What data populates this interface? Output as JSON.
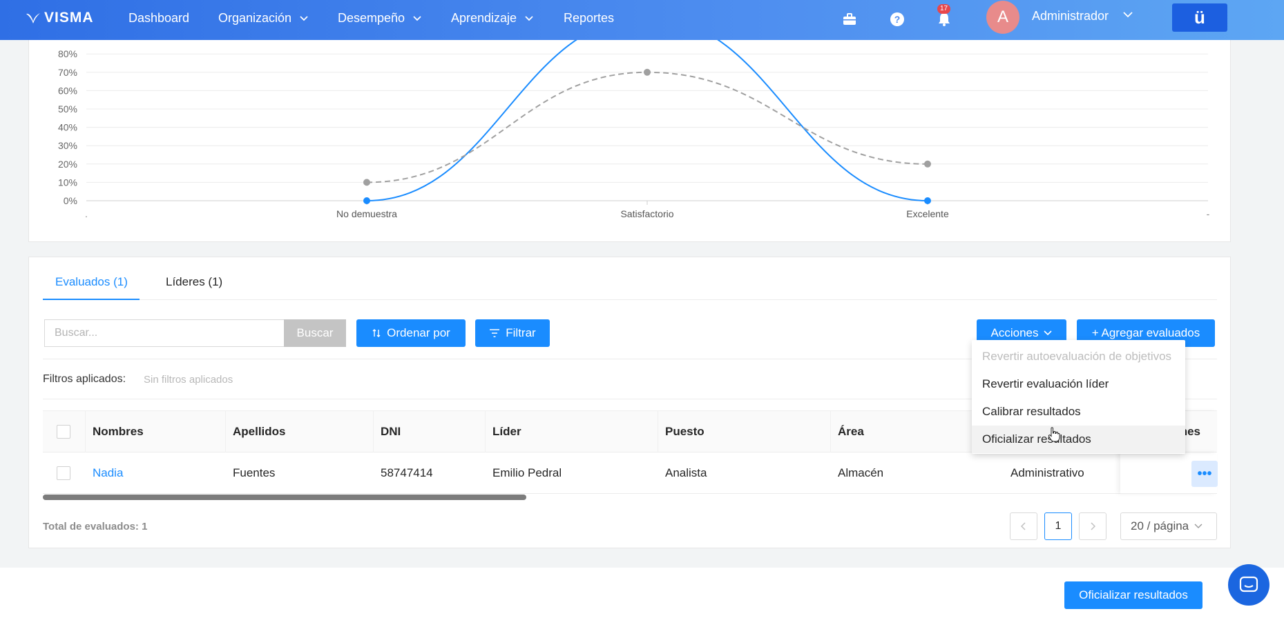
{
  "topbar": {
    "logo": "VISMA",
    "nav": [
      {
        "label": "Dashboard",
        "dropdown": false
      },
      {
        "label": "Organización",
        "dropdown": true
      },
      {
        "label": "Desempeño",
        "dropdown": true
      },
      {
        "label": "Aprendizaje",
        "dropdown": true
      },
      {
        "label": "Reportes",
        "dropdown": false
      }
    ],
    "icons": [
      "briefcase-icon",
      "help-icon",
      "bell-icon"
    ],
    "notification_count": "17",
    "avatar_initial": "A",
    "user_name": "Administrador",
    "app_button": "ü"
  },
  "chart_data": {
    "type": "line",
    "x_categories": [
      "No demuestra",
      "Satisfactorio",
      "Excelente"
    ],
    "x_edge_labels": [
      ".",
      "-"
    ],
    "y_ticks": [
      "0%",
      "10%",
      "20%",
      "30%",
      "40%",
      "50%",
      "60%",
      "70%",
      "80%"
    ],
    "ylim": [
      0,
      80
    ],
    "grid": true,
    "series": [
      {
        "values": [
          0,
          100,
          0
        ],
        "color": "#1a8cff",
        "style": "solid"
      },
      {
        "values": [
          10,
          70,
          20
        ],
        "color": "#a0a0a0",
        "style": "dashed"
      }
    ]
  },
  "tabs": [
    {
      "label": "Evaluados (1)",
      "active": true
    },
    {
      "label": "Líderes (1)",
      "active": false
    }
  ],
  "toolbar": {
    "search_placeholder": "Buscar...",
    "search_button": "Buscar",
    "sort_button": "Ordenar por",
    "filter_button": "Filtrar",
    "actions_button": "Acciones",
    "add_button": "+ Agregar evaluados"
  },
  "filters": {
    "label": "Filtros aplicados:",
    "value": "Sin filtros aplicados"
  },
  "table": {
    "columns": [
      "Nombres",
      "Apellidos",
      "DNI",
      "Líder",
      "Puesto",
      "Área",
      "",
      "nes"
    ],
    "rows": [
      {
        "nombres": "Nadia",
        "apellidos": "Fuentes",
        "dni": "58747414",
        "lider": "Emilio Pedral",
        "puesto": "Analista",
        "area": "Almacén",
        "extra": "Administrativo"
      }
    ]
  },
  "dropdown_menu": [
    {
      "label": "Revertir autoevaluación de objetivos",
      "disabled": true
    },
    {
      "label": "Revertir evaluación líder",
      "disabled": false
    },
    {
      "label": "Calibrar resultados",
      "disabled": false
    },
    {
      "label": "Oficializar resultados",
      "disabled": false,
      "hover": true
    }
  ],
  "footer": {
    "total": "Total de evaluados: 1",
    "pagination": {
      "current": "1",
      "page_size": "20 / página"
    },
    "final_button": "Oficializar resultados"
  },
  "colors": {
    "primary": "#1a8cff",
    "nav_start": "#2f6fe5",
    "nav_end": "#5da6f3",
    "disabled_button": "#c4c4c4"
  }
}
